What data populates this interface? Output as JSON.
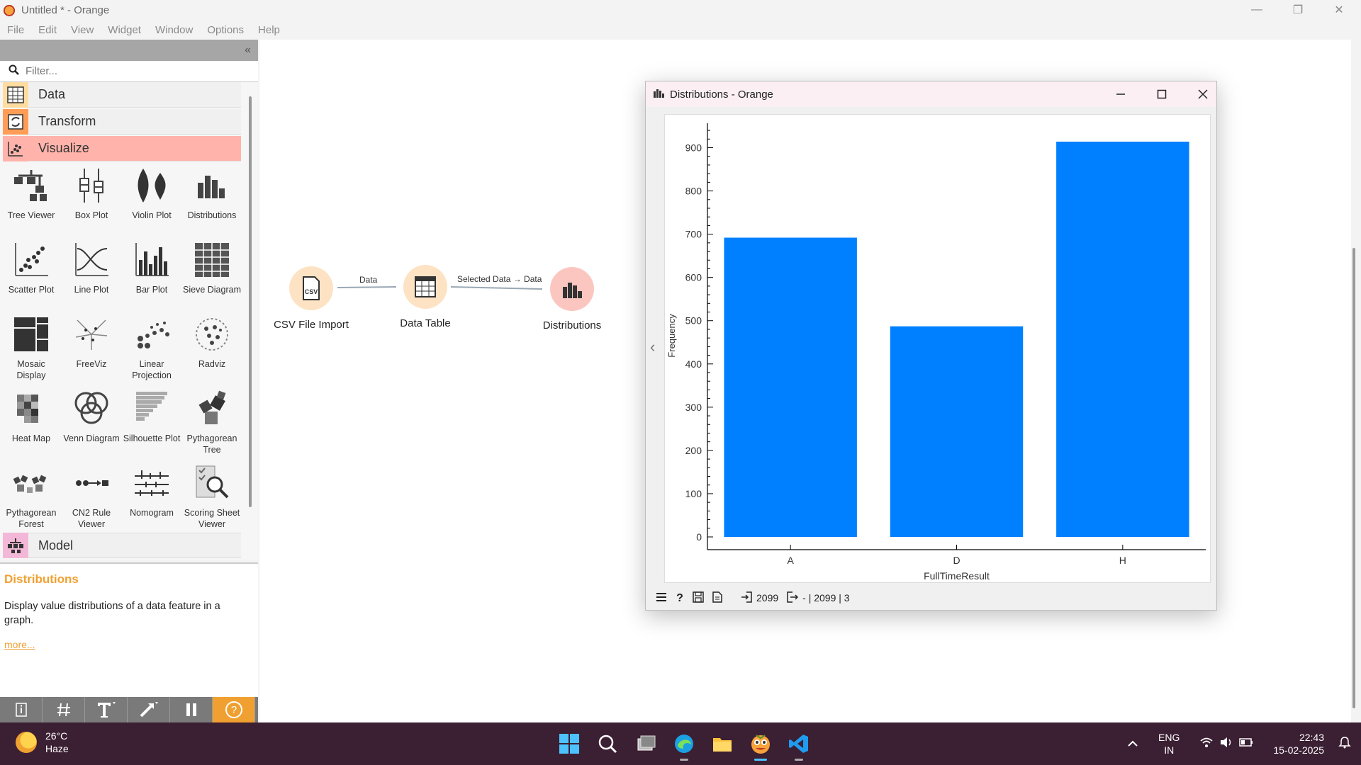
{
  "window": {
    "title": "Untitled * - Orange",
    "controls": {
      "minimize": "—",
      "maximize": "❐",
      "close": "✕"
    }
  },
  "menu": [
    "File",
    "Edit",
    "View",
    "Widget",
    "Window",
    "Options",
    "Help"
  ],
  "toolbox": {
    "collapse_icon": "«",
    "filter_placeholder": "Filter...",
    "categories": [
      {
        "label": "Data",
        "color": "#f0f0f0"
      },
      {
        "label": "Transform",
        "color": "#f0f0f0"
      },
      {
        "label": "Visualize",
        "color": "#ffb3ab"
      },
      {
        "label": "Model",
        "color": "#f0f0f0"
      }
    ],
    "widgets": [
      [
        "Tree Viewer",
        "Box Plot",
        "Violin Plot",
        "Distributions"
      ],
      [
        "Scatter Plot",
        "Line Plot",
        "Bar Plot",
        "Sieve Diagram"
      ],
      [
        "Mosaic Display",
        "FreeViz",
        "Linear Projection",
        "Radviz"
      ],
      [
        "Heat Map",
        "Venn Diagram",
        "Silhouette Plot",
        "Pythagorean Tree"
      ],
      [
        "Pythagorean Forest",
        "CN2 Rule Viewer",
        "Nomogram",
        "Scoring Sheet Viewer"
      ]
    ]
  },
  "description": {
    "title": "Distributions",
    "text": "Display value distributions of a data feature in a graph.",
    "more": "more..."
  },
  "canvas": {
    "nodes": {
      "csv": "CSV File Import",
      "table": "Data Table",
      "dist": "Distributions"
    },
    "links": {
      "link1": "Data",
      "link2": "Selected Data → Data"
    }
  },
  "dist_window": {
    "title": "Distributions - Orange",
    "status": {
      "input": "2099",
      "output": "- | 2099 | 3"
    }
  },
  "chart_data": {
    "type": "bar",
    "categories": [
      "A",
      "D",
      "H"
    ],
    "values": [
      692,
      487,
      914
    ],
    "xlabel": "FullTimeResult",
    "ylabel": "Frequency",
    "ylim": [
      0,
      950
    ],
    "yticks": [
      0,
      100,
      200,
      300,
      400,
      500,
      600,
      700,
      800,
      900
    ],
    "bar_color": "#0080ff",
    "grid": false
  },
  "taskbar": {
    "weather": {
      "temp": "26°C",
      "condition": "Haze"
    },
    "lang": {
      "line1": "ENG",
      "line2": "IN"
    },
    "clock": {
      "time": "22:43",
      "date": "15-02-2025"
    }
  }
}
